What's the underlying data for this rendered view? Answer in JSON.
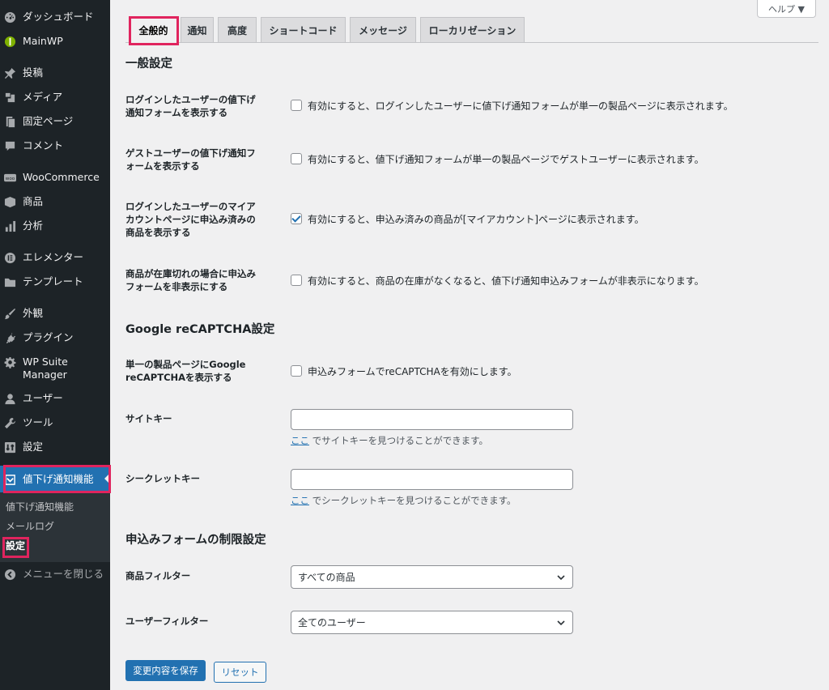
{
  "sidebar": {
    "items": [
      {
        "label": "ダッシュボード",
        "icon": "dashboard-icon"
      },
      {
        "label": "MainWP",
        "icon": "mainwp-icon"
      },
      {
        "label": "投稿",
        "icon": "pin-icon"
      },
      {
        "label": "メディア",
        "icon": "media-icon"
      },
      {
        "label": "固定ページ",
        "icon": "page-icon"
      },
      {
        "label": "コメント",
        "icon": "comment-icon"
      },
      {
        "label": "WooCommerce",
        "icon": "woocommerce-icon"
      },
      {
        "label": "商品",
        "icon": "product-box-icon"
      },
      {
        "label": "分析",
        "icon": "bar-chart-icon"
      },
      {
        "label": "エレメンター",
        "icon": "elementor-icon"
      },
      {
        "label": "テンプレート",
        "icon": "folder-icon"
      },
      {
        "label": "外観",
        "icon": "brush-icon"
      },
      {
        "label": "プラグイン",
        "icon": "plugin-icon"
      },
      {
        "label": "WP Suite\nManager",
        "icon": "gear-icon"
      },
      {
        "label": "ユーザー",
        "icon": "user-icon"
      },
      {
        "label": "ツール",
        "icon": "wrench-icon"
      },
      {
        "label": "設定",
        "icon": "settings-icon"
      },
      {
        "label": "値下げ通知機能",
        "icon": "price-drop-icon"
      }
    ],
    "submenu": [
      "値下げ通知機能",
      "メールログ",
      "設定"
    ],
    "collapse_label": "メニューを閉じる"
  },
  "help_label": "ヘルプ ▼",
  "tabs": [
    "全般的",
    "通知",
    "高度",
    "ショートコード",
    "メッセージ",
    "ローカリゼーション"
  ],
  "general": {
    "title": "一般設定",
    "rows": [
      {
        "label": "ログインしたユーザーの値下げ\n通知フォームを表示する",
        "text": "有効にすると、ログインしたユーザーに値下げ通知フォームが単一の製品ページに表示されます。",
        "checked": false
      },
      {
        "label": "ゲストユーザーの値下げ通知フ\nォームを表示する",
        "text": "有効にすると、値下げ通知フォームが単一の製品ページでゲストユーザーに表示されます。",
        "checked": false
      },
      {
        "label": "ログインしたユーザーのマイア\nカウントページに申込み済みの\n商品を表示する",
        "text": "有効にすると、申込み済みの商品が[マイアカウント]ページに表示されます。",
        "checked": true
      },
      {
        "label": "商品が在庫切れの場合に申込み\nフォームを非表示にする",
        "text": "有効にすると、商品の在庫がなくなると、値下げ通知申込みフォームが非表示になります。",
        "checked": false
      }
    ]
  },
  "recaptcha": {
    "title": "Google reCAPTCHA設定",
    "enable_label": "単一の製品ページにGoogle\nreCAPTCHAを表示する",
    "enable_text": "申込みフォームでreCAPTCHAを有効にします。",
    "site_key_label": "サイトキー",
    "site_key_value": "",
    "site_key_link": "ここ",
    "site_key_desc": " でサイトキーを見つけることができます。",
    "secret_key_label": "シークレットキー",
    "secret_key_value": "",
    "secret_key_link": "ここ",
    "secret_key_desc": " でシークレットキーを見つけることができます。"
  },
  "restrictions": {
    "title": "申込みフォームの制限設定",
    "product_filter_label": "商品フィルター",
    "product_filter_value": "すべての商品",
    "user_filter_label": "ユーザーフィルター",
    "user_filter_value": "全てのユーザー"
  },
  "buttons": {
    "save": "変更内容を保存",
    "reset": "リセット"
  },
  "colors": {
    "sidebar_bg": "#1d2327",
    "accent": "#2271b1",
    "highlight": "#e0245e"
  }
}
